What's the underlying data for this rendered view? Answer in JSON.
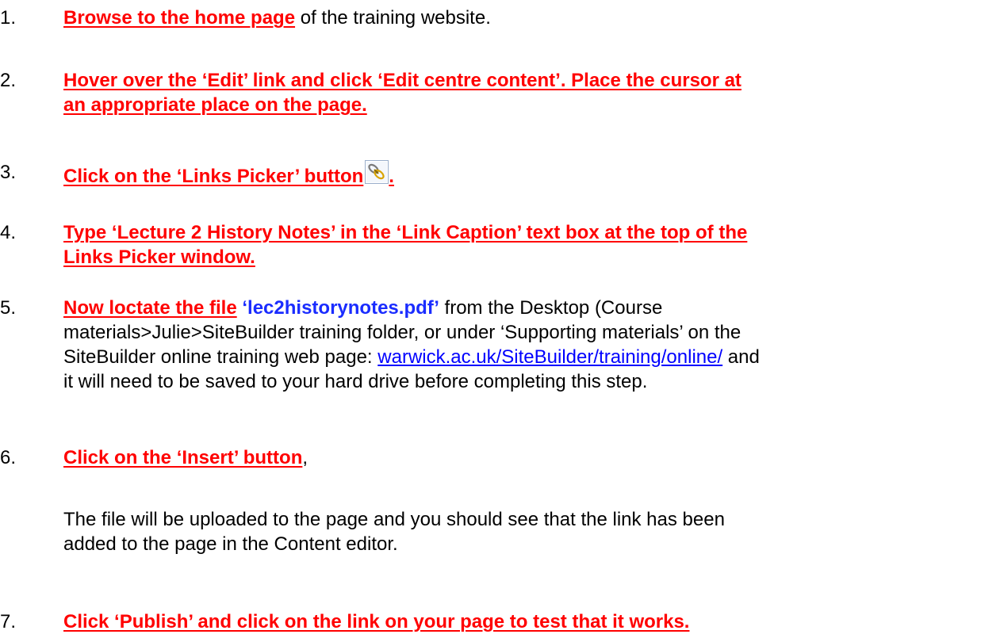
{
  "steps": [
    {
      "number": "1.",
      "link": "Browse to the home page",
      "rest": " of the training website."
    },
    {
      "number": "2.",
      "line1": "Hover over the ‘Edit’ link and click ‘Edit centre content’.  Place the cursor at",
      "line2": "an appropriate place on the page."
    },
    {
      "number": "3.",
      "link": "Click on the ‘Links Picker’ button",
      "icon": "links-picker-icon",
      "after": "."
    },
    {
      "number": "4.",
      "line1": "Type ‘Lecture 2 History Notes’ in the ‘Link Caption’ text box at the top of the",
      "line2": "Links Picker window."
    },
    {
      "number": "5.",
      "link": "Now loctate the file",
      "filename": "‘lec2historynotes.pdf’",
      "rest1": " from the Desktop (Course",
      "line2": "materials>Julie>SiteBuilder training folder, or under ‘Supporting materials’ on the",
      "line3a": "SiteBuilder online training web page: ",
      "url": "warwick.ac.uk/SiteBuilder/training/online/",
      "line3b": " and",
      "line4": "it will need to be saved to your hard drive before completing this step."
    },
    {
      "number": "6.",
      "link": "Click on the ‘Insert’ button",
      "rest": ","
    },
    {
      "number": "7.",
      "link": "Click ‘Publish’ and click on the link on your page to test that it works."
    }
  ],
  "note": {
    "line1": "The file will be uploaded to the page and you should see that the link has been",
    "line2": "added to the page in the Content editor."
  },
  "colors": {
    "instruction": "#ff0000",
    "filename": "#1a2cff",
    "hyperlink": "#0000ff"
  }
}
